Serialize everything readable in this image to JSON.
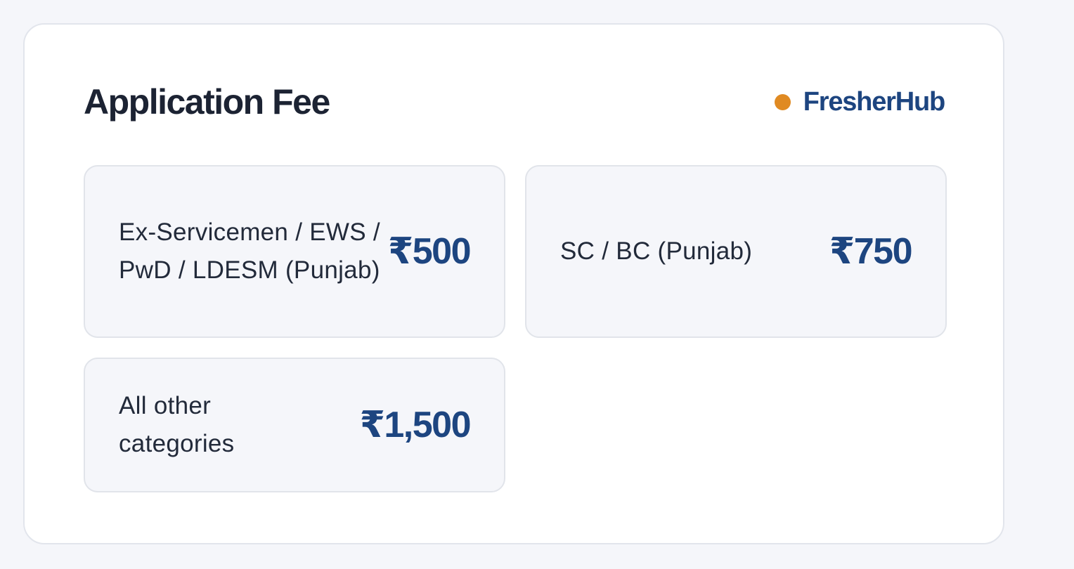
{
  "section": {
    "title": "Application Fee",
    "brand": {
      "name": "FresherHub",
      "dot_color": "#e08a22",
      "text_color": "#1d4580"
    }
  },
  "fees": [
    {
      "category": "Ex-Servicemen / EWS / PwD / LDESM (Punjab)",
      "amount": "₹500"
    },
    {
      "category": "SC / BC (Punjab)",
      "amount": "₹750"
    },
    {
      "category": "All other categories",
      "amount": "₹1,500"
    }
  ]
}
